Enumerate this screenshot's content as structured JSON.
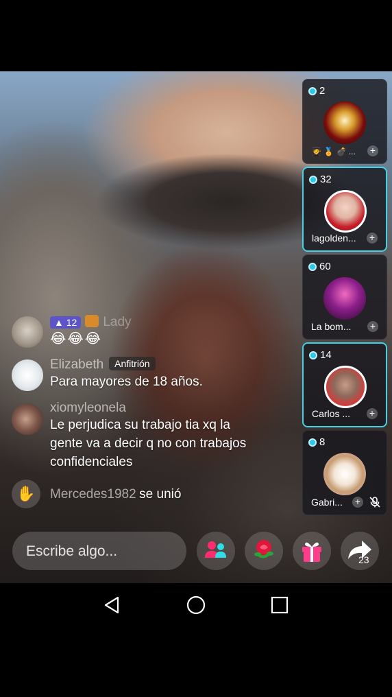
{
  "guests": [
    {
      "count": "2",
      "name": "",
      "icons": "🧑‍🎓 🏅 💣 ..."
    },
    {
      "count": "32",
      "name": "lagolden..."
    },
    {
      "count": "60",
      "name": "La bom..."
    },
    {
      "count": "14",
      "name": "Carlos ..."
    },
    {
      "count": "8",
      "name": "Gabri..."
    }
  ],
  "chat": {
    "msg1": {
      "level": "12",
      "name": "Lady",
      "emojis": "😂😂😂"
    },
    "msg2": {
      "name": "Elizabeth",
      "badge": "Anfitrión",
      "text": "Para mayores de 18 años."
    },
    "msg3": {
      "name": "xiomyleonela",
      "text": "Le perjudica su trabajo tia xq la gente va a decir q no con trabajos confidenciales"
    },
    "msg4": {
      "name": "Mercedes1982",
      "text": "se unió"
    }
  },
  "input": {
    "placeholder": "Escribe algo..."
  },
  "share": {
    "count": "23"
  },
  "colors": {
    "accent": "#3fd3e8",
    "gift": "#ff3d8b",
    "guest_icon": "#ff2d6f"
  },
  "icons": [
    "guest-mode-icon",
    "rose-icon",
    "gift-icon",
    "share-icon",
    "back-icon",
    "home-icon",
    "recents-icon",
    "mic-off-icon",
    "plus-icon"
  ]
}
